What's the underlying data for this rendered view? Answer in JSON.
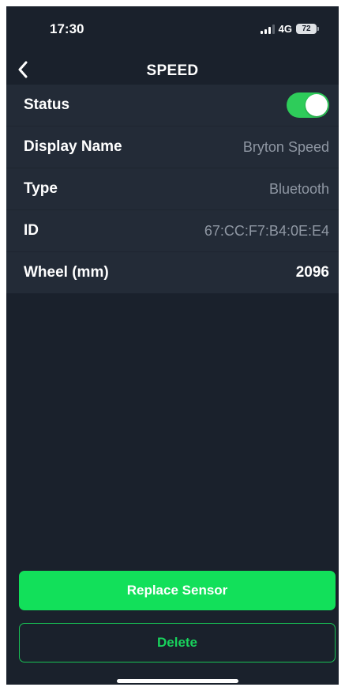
{
  "status_bar": {
    "time": "17:30",
    "network": "4G",
    "battery": "72"
  },
  "nav": {
    "title": "SPEED"
  },
  "settings": {
    "status": {
      "label": "Status",
      "enabled": true
    },
    "display_name": {
      "label": "Display Name",
      "value": "Bryton Speed"
    },
    "type": {
      "label": "Type",
      "value": "Bluetooth"
    },
    "id": {
      "label": "ID",
      "value": "67:CC:F7:B4:0E:E4"
    },
    "wheel": {
      "label": "Wheel (mm)",
      "value": "2096"
    }
  },
  "actions": {
    "replace_label": "Replace Sensor",
    "delete_label": "Delete"
  },
  "colors": {
    "background": "#1a212c",
    "list_background": "#232b37",
    "accent_green": "#12e05a",
    "toggle_green": "#2ecc5a",
    "secondary_text": "#8f97a3"
  },
  "icons": {
    "back": "chevron-left-icon",
    "signal": "signal-bars-icon",
    "battery": "battery-icon"
  }
}
